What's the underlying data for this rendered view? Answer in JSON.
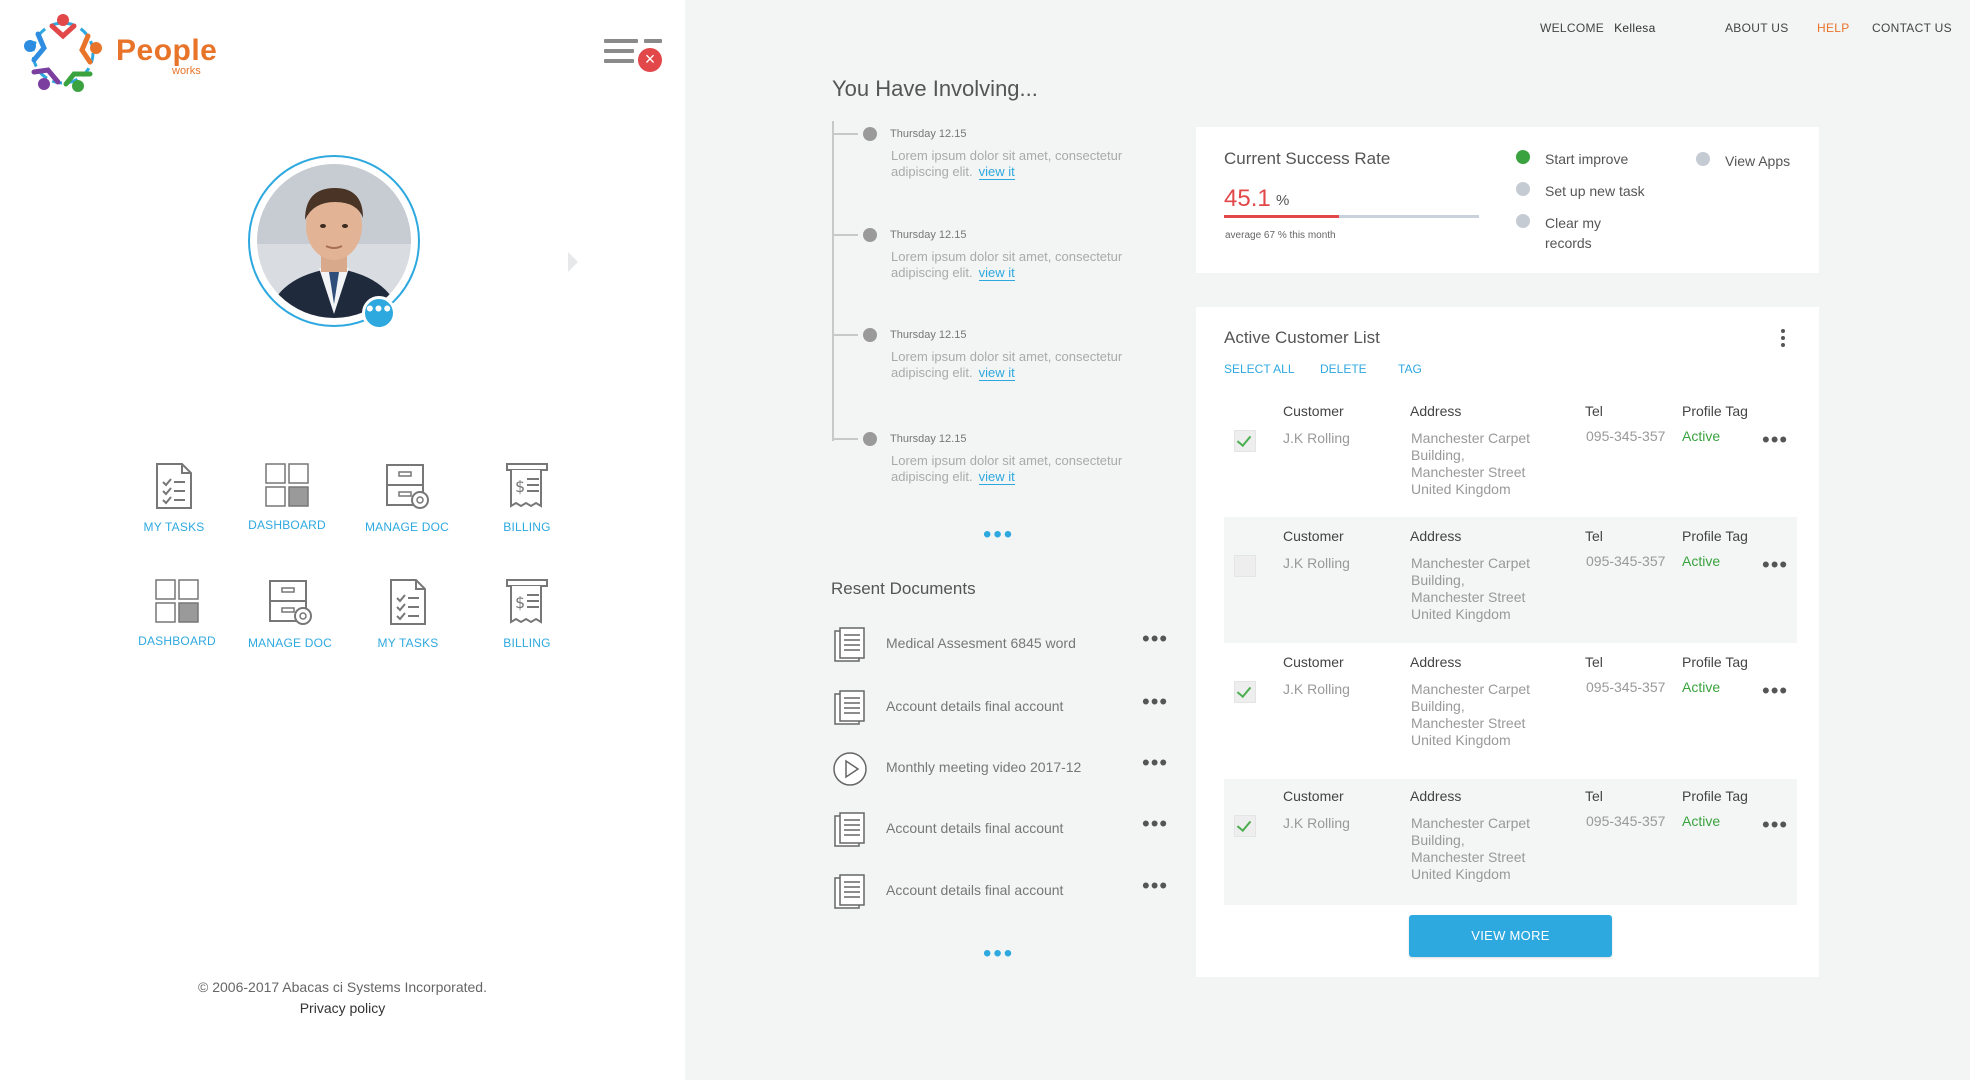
{
  "brand": {
    "name": "People",
    "sub": "works"
  },
  "header": {
    "welcome_label": "WELCOME",
    "user_name": "Kellesa",
    "nav": {
      "about": "ABOUT US",
      "help": "HELP",
      "contact": "CONTACT US"
    }
  },
  "shortcuts": [
    {
      "label": "MY TASKS",
      "icon": "tasks-icon"
    },
    {
      "label": "DASHBOARD",
      "icon": "dashboard-icon"
    },
    {
      "label": "MANAGE DOC",
      "icon": "manage-doc-icon"
    },
    {
      "label": "BILLING",
      "icon": "billing-icon"
    },
    {
      "label": "DASHBOARD",
      "icon": "dashboard-icon"
    },
    {
      "label": "MANAGE DOC",
      "icon": "manage-doc-icon"
    },
    {
      "label": "MY TASKS",
      "icon": "tasks-icon"
    },
    {
      "label": "BILLING",
      "icon": "billing-icon"
    }
  ],
  "footer": {
    "copyright": "© 2006-2017 Abacas ci Systems Incorporated.",
    "privacy": "Privacy policy"
  },
  "timeline": {
    "title": "You Have Involving...",
    "items": [
      {
        "date": "Thursday 12.15",
        "text": "Lorem ipsum dolor sit amet, consectetur adipiscing elit.",
        "link": "view it"
      },
      {
        "date": "Thursday 12.15",
        "text": "Lorem ipsum dolor sit amet, consectetur adipiscing elit.",
        "link": "view it"
      },
      {
        "date": "Thursday 12.15",
        "text": "Lorem ipsum dolor sit amet, consectetur adipiscing elit.",
        "link": "view it"
      },
      {
        "date": "Thursday 12.15",
        "text": "Lorem ipsum dolor sit amet, consectetur adipiscing elit.",
        "link": "view it"
      }
    ],
    "more": "•••"
  },
  "documents": {
    "title": "Resent Documents",
    "items": [
      {
        "name": "Medical Assesment 6845 word",
        "icon": "document-icon",
        "menu": "•••"
      },
      {
        "name": "Account details final account",
        "icon": "document-icon",
        "menu": "•••"
      },
      {
        "name": "Monthly meeting video 2017-12",
        "icon": "play-icon",
        "menu": "•••"
      },
      {
        "name": "Account details final account",
        "icon": "document-icon",
        "menu": "•••"
      },
      {
        "name": "Account details final account",
        "icon": "document-icon",
        "menu": "•••"
      }
    ],
    "more": "•••"
  },
  "success_rate": {
    "title": "Current Success Rate",
    "value": "45.1",
    "unit": "%",
    "progress": 0.451,
    "note": "average 67 % this month",
    "options": [
      {
        "label": "Start improve",
        "active": true
      },
      {
        "label": "Set up new task",
        "active": false
      },
      {
        "label": "Clear my records",
        "active": false
      },
      {
        "label": "View Apps",
        "active": false
      }
    ]
  },
  "customers": {
    "title": "Active Customer List",
    "actions": {
      "select_all": "SELECT ALL",
      "delete": "DELETE",
      "tag": "TAG"
    },
    "headers": {
      "customer": "Customer",
      "address": "Address",
      "tel": "Tel",
      "tag": "Profile Tag"
    },
    "rows": [
      {
        "checked": true,
        "customer": "J.K Rolling",
        "address": "Manchester Carpet Building, Manchester Street United Kingdom",
        "tel": "095-345-357",
        "tag": "Active",
        "menu": "•••"
      },
      {
        "checked": false,
        "customer": "J.K Rolling",
        "address": "Manchester Carpet Building, Manchester Street United Kingdom",
        "tel": "095-345-357",
        "tag": "Active",
        "menu": "•••"
      },
      {
        "checked": true,
        "customer": "J.K Rolling",
        "address": "Manchester Carpet Building, Manchester Street United Kingdom",
        "tel": "095-345-357",
        "tag": "Active",
        "menu": "•••"
      },
      {
        "checked": true,
        "customer": "J.K Rolling",
        "address": "Manchester Carpet Building, Manchester Street United Kingdom",
        "tel": "095-345-357",
        "tag": "Active",
        "menu": "•••"
      }
    ],
    "view_more": "VIEW MORE"
  },
  "colors": {
    "accent": "#2ea9e0",
    "brand": "#e8742a",
    "danger": "#e2474a",
    "success": "#3aa33f"
  }
}
